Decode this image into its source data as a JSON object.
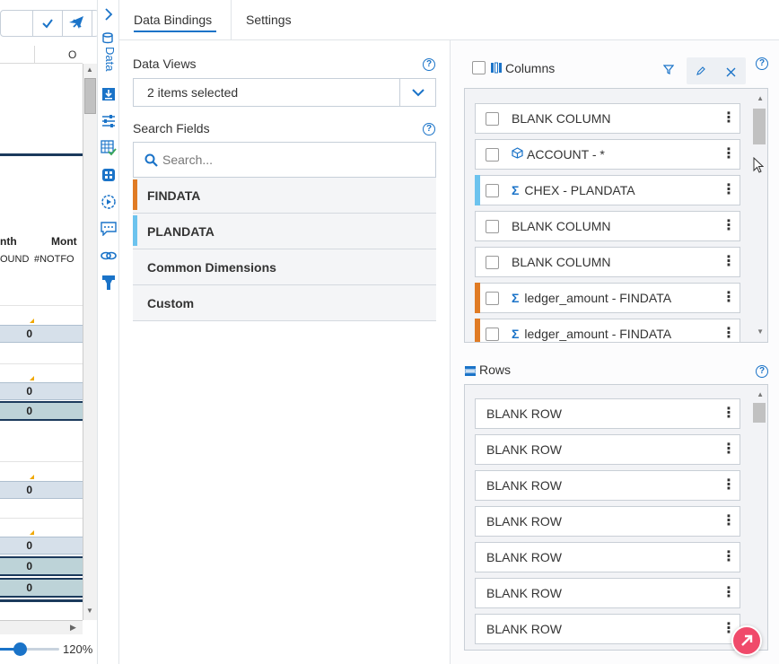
{
  "spreadsheet": {
    "column_letter": "O",
    "header_month_1": "nth",
    "header_month_2": "Mont",
    "notfound_1": "OUND",
    "notfound_2": "#NOTFO",
    "cell_values": [
      "0",
      "0",
      "0",
      "0",
      "0",
      "0",
      "0"
    ],
    "zoom_value": 0.33,
    "zoom_label": "120%"
  },
  "toolbar": {
    "confirm_icon": "check-icon",
    "cancel_icon": "close-icon",
    "send_icon": "send-icon"
  },
  "rail": {
    "collapse_icon": "chevron-right-icon",
    "data_label": "Data",
    "icons": [
      "database-icon",
      "import-icon",
      "sliders-icon",
      "grid-check-icon",
      "grid-icon",
      "gear-play-icon",
      "comment-icon",
      "link-icon",
      "filter-icon"
    ]
  },
  "tabs": [
    {
      "label": "Data Bindings",
      "active": true
    },
    {
      "label": "Settings",
      "active": false
    }
  ],
  "data_views": {
    "label": "Data Views",
    "selected": "2 items selected"
  },
  "search_fields": {
    "label": "Search Fields",
    "placeholder": "Search...",
    "value": "",
    "items": [
      {
        "label": "FINDATA",
        "color": "#e07b24"
      },
      {
        "label": "PLANDATA",
        "color": "#6cc3ee"
      },
      {
        "label": "Common Dimensions",
        "color": ""
      },
      {
        "label": "Custom",
        "color": ""
      }
    ]
  },
  "columns": {
    "label": "Columns",
    "items": [
      {
        "label": "BLANK COLUMN",
        "prefix": "",
        "stripe": ""
      },
      {
        "label": "ACCOUNT - *",
        "prefix": "cube",
        "stripe": ""
      },
      {
        "label": "CHEX - PLANDATA",
        "prefix": "sigma",
        "stripe": "#6cc3ee"
      },
      {
        "label": "BLANK COLUMN",
        "prefix": "",
        "stripe": ""
      },
      {
        "label": "BLANK COLUMN",
        "prefix": "",
        "stripe": ""
      },
      {
        "label": "ledger_amount - FINDATA",
        "prefix": "sigma",
        "stripe": "#e07b24"
      },
      {
        "label": "ledger_amount - FINDATA",
        "prefix": "sigma",
        "stripe": "#e07b24"
      }
    ]
  },
  "rows": {
    "label": "Rows",
    "items": [
      "BLANK ROW",
      "BLANK ROW",
      "BLANK ROW",
      "BLANK ROW",
      "BLANK ROW",
      "BLANK ROW",
      "BLANK ROW"
    ]
  },
  "colors": {
    "accent": "#1a73c8",
    "findata": "#e07b24",
    "plandata": "#6cc3ee",
    "fab": "#f04a6a"
  }
}
